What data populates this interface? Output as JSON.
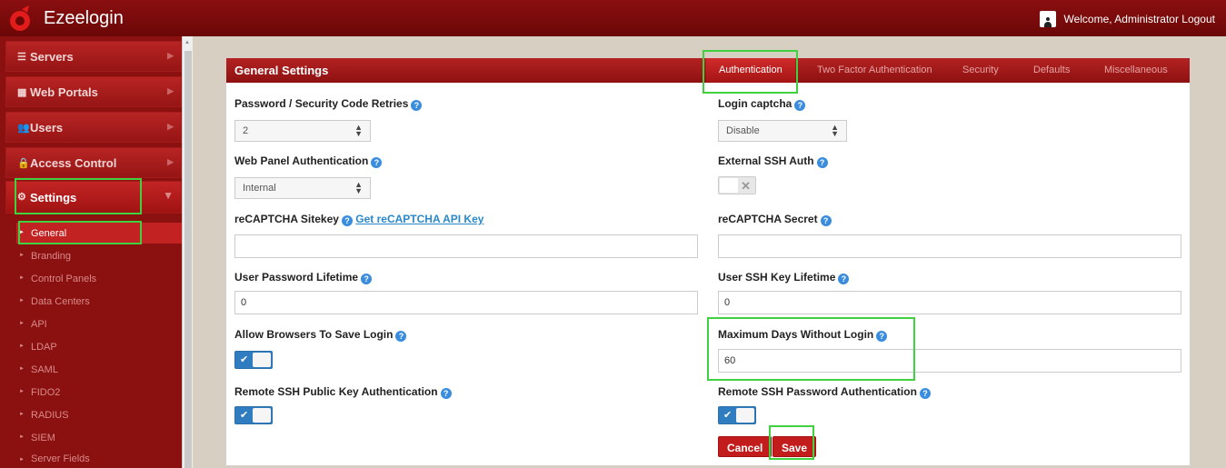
{
  "app": {
    "brand": "Ezeelogin",
    "welcome": "Welcome, Administrator Logout"
  },
  "sidebar": {
    "nav": [
      {
        "label": "Servers",
        "icon": "list-icon"
      },
      {
        "label": "Web Portals",
        "icon": "grid-icon"
      },
      {
        "label": "Users",
        "icon": "users-icon"
      },
      {
        "label": "Access Control",
        "icon": "lock-icon"
      },
      {
        "label": "Settings",
        "icon": "gears-icon"
      }
    ],
    "settings_sub": [
      "General",
      "Branding",
      "Control Panels",
      "Data Centers",
      "API",
      "LDAP",
      "SAML",
      "FIDO2",
      "RADIUS",
      "SIEM",
      "Server Fields"
    ]
  },
  "panel": {
    "title": "General Settings",
    "tabs": [
      "Authentication",
      "Two Factor Authentication",
      "Security",
      "Defaults",
      "Miscellaneous"
    ]
  },
  "form": {
    "retries": {
      "label": "Password / Security Code Retries",
      "value": "2"
    },
    "captcha": {
      "label": "Login captcha",
      "value": "Disable"
    },
    "web_auth": {
      "label": "Web Panel Authentication",
      "value": "Internal"
    },
    "ext_ssh": {
      "label": "External SSH Auth",
      "state": "off"
    },
    "sitekey": {
      "label": "reCAPTCHA Sitekey",
      "link": "Get reCAPTCHA API Key",
      "value": ""
    },
    "secret": {
      "label": "reCAPTCHA Secret",
      "value": ""
    },
    "pwd_lifetime": {
      "label": "User Password Lifetime",
      "value": "0"
    },
    "ssh_key_lifetime": {
      "label": "User SSH Key Lifetime",
      "value": "0"
    },
    "allow_save": {
      "label": "Allow Browsers To Save Login",
      "state": "on"
    },
    "max_days": {
      "label": "Maximum Days Without Login",
      "value": "60"
    },
    "remote_pubkey": {
      "label": "Remote SSH Public Key Authentication",
      "state": "on"
    },
    "remote_pwd": {
      "label": "Remote SSH Password Authentication",
      "state": "on"
    },
    "cancel": "Cancel",
    "save": "Save"
  },
  "colors": {
    "header": "#8b1010",
    "accent": "#c21c1c",
    "highlight": "#3fd13f",
    "toggle": "#2f7cc0"
  }
}
